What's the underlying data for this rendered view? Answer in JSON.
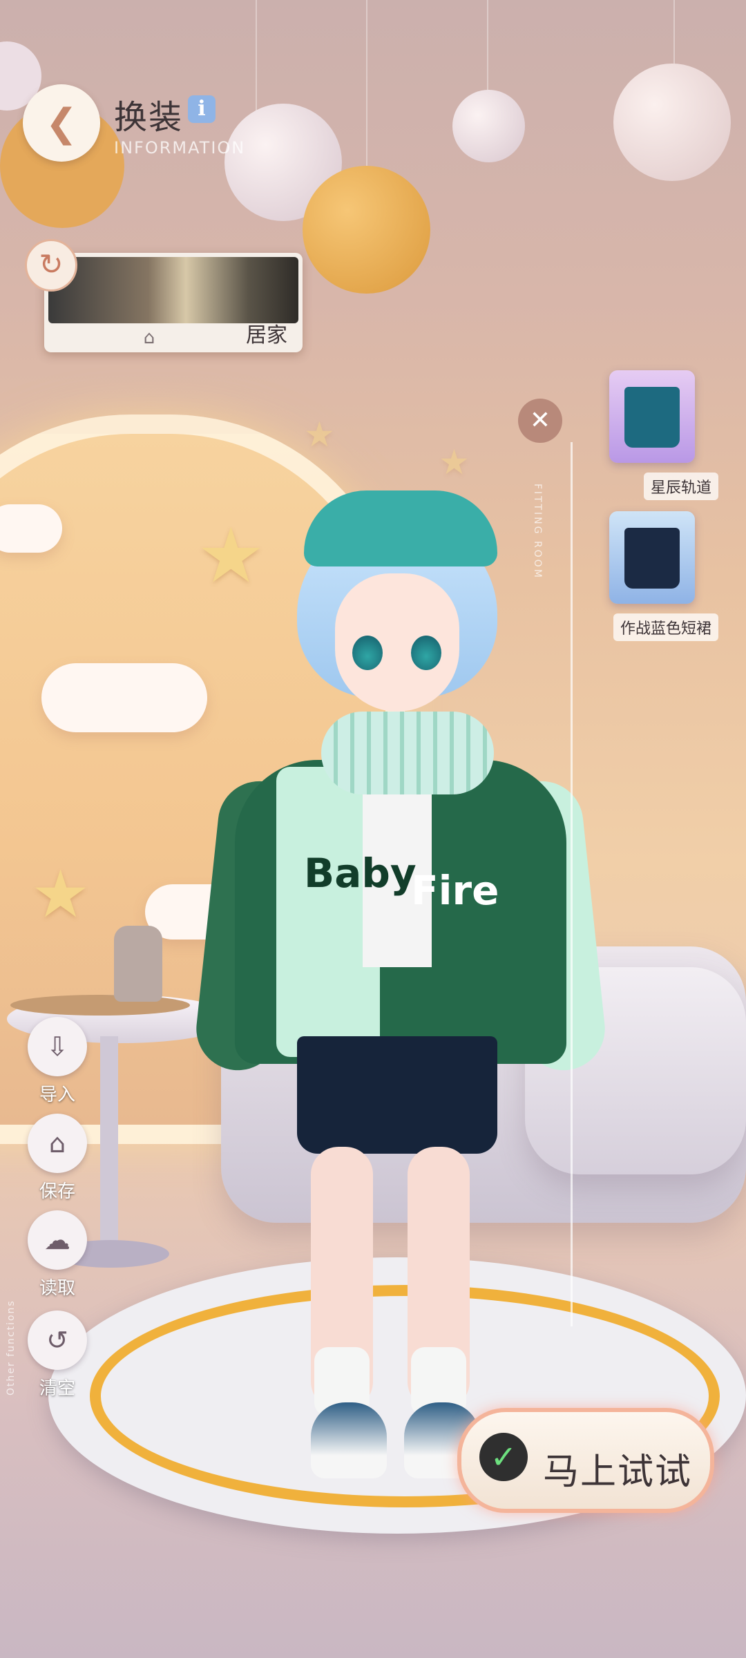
{
  "header": {
    "title": "换装",
    "subtitle": "INFORMATION",
    "back_icon": "back-arrow-icon",
    "info_icon_glyph": "i"
  },
  "scene_selector": {
    "label": "居家",
    "icon": "home-icon"
  },
  "fitting_room": {
    "vertical_label": "FITTING ROOM",
    "items": [
      {
        "label": "星辰轨道",
        "color": "#1d6a80"
      },
      {
        "label": "作战蓝色短裙",
        "color": "#1b2a44"
      }
    ]
  },
  "character_outfit": {
    "jacket_text_left": "Baby",
    "jacket_text_right": "Fire"
  },
  "side_actions": {
    "import_label": "导入",
    "save_label": "保存",
    "load_label": "读取",
    "clear_label": "清空",
    "section_label": "Other functions"
  },
  "try_button": {
    "label": "马上试试"
  },
  "colors": {
    "accent": "#f4b49a",
    "title_text": "#3d3437"
  }
}
